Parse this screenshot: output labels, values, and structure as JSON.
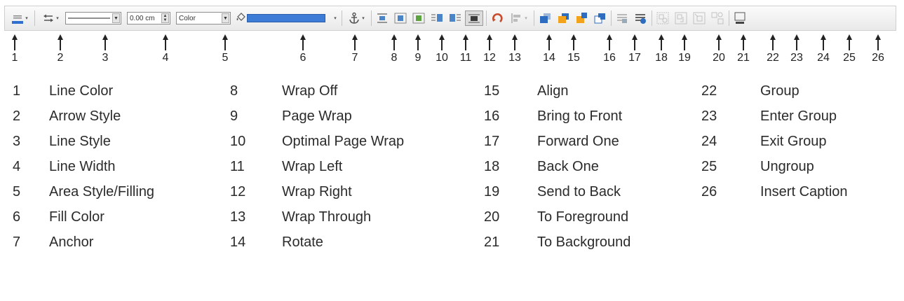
{
  "toolbar": {
    "line_width_value": "0.00 cm",
    "area_style_value": "Color"
  },
  "callout_numbers": [
    "1",
    "2",
    "3",
    "4",
    "5",
    "6",
    "7",
    "8",
    "9",
    "10",
    "11",
    "12",
    "13",
    "14",
    "15",
    "16",
    "17",
    "18",
    "19",
    "20",
    "21",
    "22",
    "23",
    "24",
    "25",
    "26"
  ],
  "legend": {
    "columns": [
      [
        {
          "num": "1",
          "label": "Line Color"
        },
        {
          "num": "2",
          "label": "Arrow Style"
        },
        {
          "num": "3",
          "label": "Line Style"
        },
        {
          "num": "4",
          "label": "Line Width"
        },
        {
          "num": "5",
          "label": "Area Style/Filling"
        },
        {
          "num": "6",
          "label": "Fill Color"
        },
        {
          "num": "7",
          "label": "Anchor"
        }
      ],
      [
        {
          "num": "8",
          "label": "Wrap Off"
        },
        {
          "num": "9",
          "label": "Page Wrap"
        },
        {
          "num": "10",
          "label": "Optimal Page Wrap"
        },
        {
          "num": "11",
          "label": "Wrap Left"
        },
        {
          "num": "12",
          "label": "Wrap Right"
        },
        {
          "num": "13",
          "label": "Wrap Through"
        },
        {
          "num": "14",
          "label": "Rotate"
        }
      ],
      [
        {
          "num": "15",
          "label": "Align"
        },
        {
          "num": "16",
          "label": "Bring to Front"
        },
        {
          "num": "17",
          "label": "Forward One"
        },
        {
          "num": "18",
          "label": "Back One"
        },
        {
          "num": "19",
          "label": "Send to Back"
        },
        {
          "num": "20",
          "label": "To Foreground"
        },
        {
          "num": "21",
          "label": "To Background"
        }
      ],
      [
        {
          "num": "22",
          "label": "Group"
        },
        {
          "num": "23",
          "label": "Enter Group"
        },
        {
          "num": "24",
          "label": "Exit Group"
        },
        {
          "num": "25",
          "label": "Ungroup"
        },
        {
          "num": "26",
          "label": "Insert Caption"
        }
      ]
    ]
  },
  "colors": {
    "line_color_bar": "#2f6fd0",
    "fill_color_bar": "#3c7bd6",
    "rotate_icon": "#c94a2c",
    "orange_block": "#f2a21b"
  }
}
